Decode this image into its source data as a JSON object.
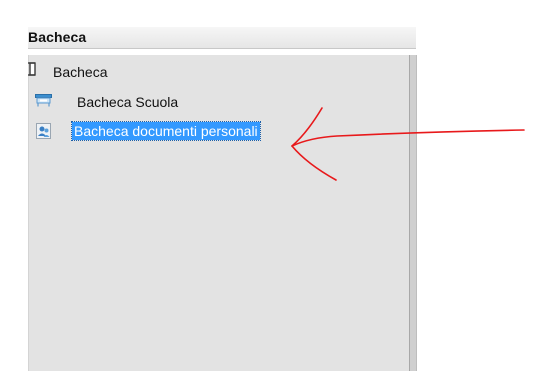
{
  "panel": {
    "title": "Bacheca"
  },
  "tree": {
    "root_label": "Bacheca",
    "items": [
      {
        "label": "Bacheca Scuola",
        "icon": "school-board-icon",
        "selected": false
      },
      {
        "label": "Bacheca documenti personali",
        "icon": "personal-documents-icon",
        "selected": true
      }
    ]
  },
  "colors": {
    "selection": "#3399ff",
    "panel_background": "#e3e3e3",
    "annotation_arrow": "#e8191b"
  }
}
